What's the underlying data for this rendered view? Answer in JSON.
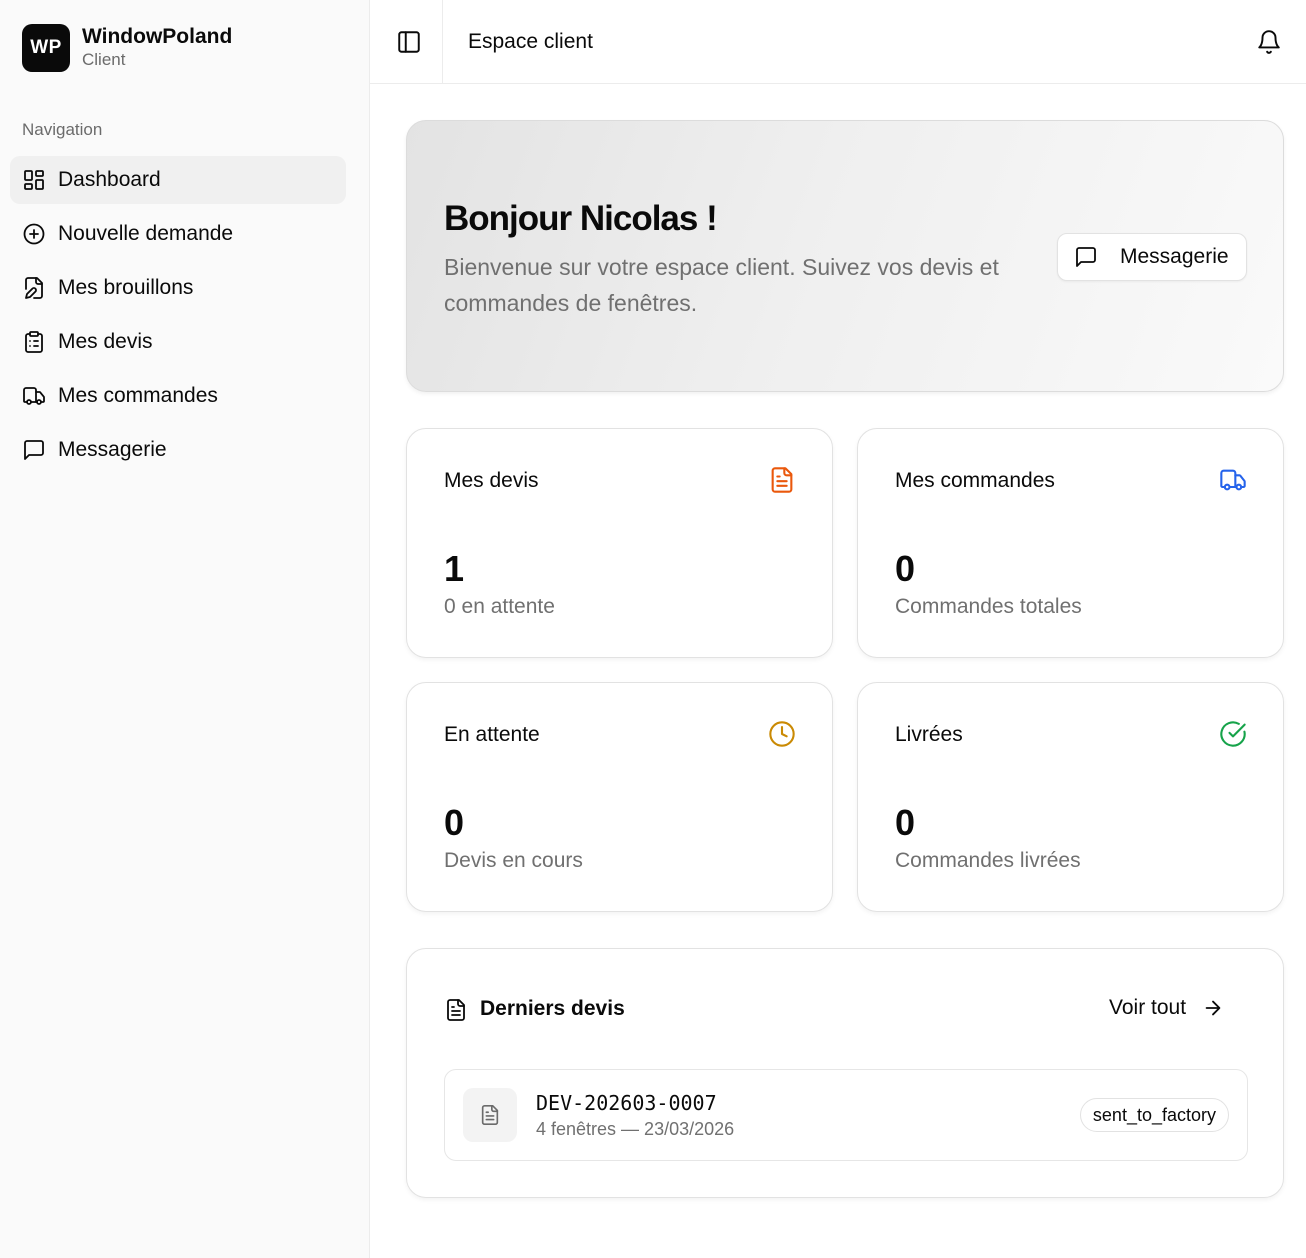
{
  "brand": {
    "logo": "WP",
    "name": "WindowPoland",
    "role": "Client"
  },
  "sidebar": {
    "section_label": "Navigation",
    "items": [
      {
        "label": "Dashboard",
        "icon": "dashboard-grid-icon",
        "active": true
      },
      {
        "label": "Nouvelle demande",
        "icon": "plus-circle-icon"
      },
      {
        "label": "Mes brouillons",
        "icon": "file-edit-icon"
      },
      {
        "label": "Mes devis",
        "icon": "clipboard-list-icon"
      },
      {
        "label": "Mes commandes",
        "icon": "truck-icon"
      },
      {
        "label": "Messagerie",
        "icon": "message-square-icon"
      }
    ]
  },
  "header": {
    "title": "Espace client"
  },
  "hero": {
    "title": "Bonjour Nicolas !",
    "subtitle": "Bienvenue sur votre espace client. Suivez vos devis et commandes de fenêtres.",
    "button_label": "Messagerie"
  },
  "stats": [
    {
      "title": "Mes devis",
      "value": "1",
      "sub": "0 en attente",
      "icon": "file-text-icon",
      "color": "#ea580c"
    },
    {
      "title": "Mes commandes",
      "value": "0",
      "sub": "Commandes totales",
      "icon": "truck-icon",
      "color": "#2563eb"
    },
    {
      "title": "En attente",
      "value": "0",
      "sub": "Devis en cours",
      "icon": "clock-icon",
      "color": "#ca8a04"
    },
    {
      "title": "Livrées",
      "value": "0",
      "sub": "Commandes livrées",
      "icon": "check-circle-icon",
      "color": "#16a34a"
    }
  ],
  "recent": {
    "title": "Derniers devis",
    "see_all": "Voir tout",
    "quotes": [
      {
        "ref": "DEV-202603-0007",
        "meta": "4 fenêtres — 23/03/2026",
        "status": "sent_to_factory"
      }
    ]
  }
}
